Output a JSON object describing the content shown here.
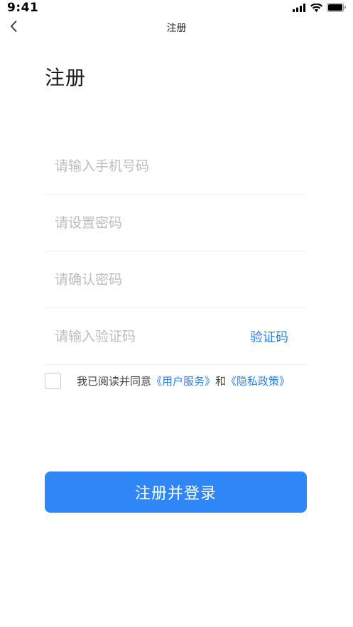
{
  "status_bar": {
    "time": "9:41",
    "icons": [
      "signal-icon",
      "wifi-icon",
      "battery-icon"
    ]
  },
  "nav": {
    "back_icon": "chevron-left-icon",
    "title": "注册"
  },
  "page": {
    "title": "注册"
  },
  "form": {
    "phone": {
      "value": "",
      "placeholder": "请输入手机号码"
    },
    "password": {
      "value": "",
      "placeholder": "请设置密码"
    },
    "confirm_password": {
      "value": "",
      "placeholder": "请确认密码"
    },
    "code": {
      "value": "",
      "placeholder": "请输入验证码",
      "button_label": "验证码"
    }
  },
  "agreement": {
    "checked": false,
    "prefix": "我已阅读并同意",
    "link_service": "《用户服务》",
    "conjunction": "和",
    "link_privacy": "《隐私政策》"
  },
  "submit": {
    "label": "注册并登录"
  },
  "colors": {
    "primary": "#2f86f6",
    "link": "#2f7fe0",
    "placeholder": "#bdbdbd",
    "divider": "#eeeeee"
  }
}
